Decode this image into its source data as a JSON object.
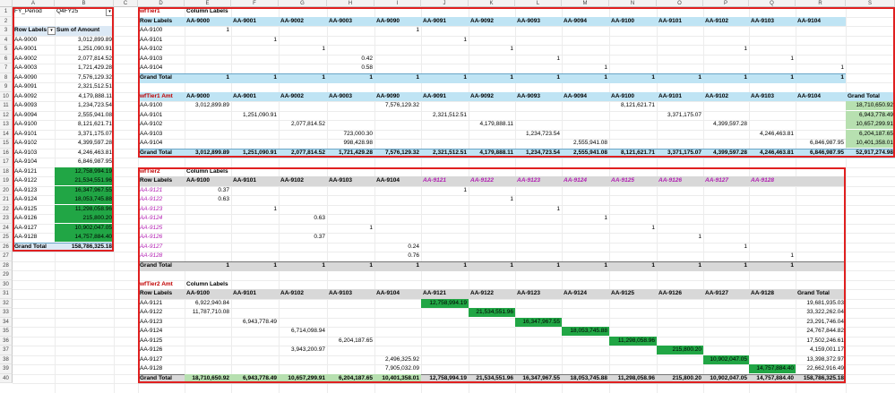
{
  "columns": [
    "A",
    "B",
    "C",
    "D",
    "E",
    "F",
    "G",
    "H",
    "I",
    "J",
    "K",
    "L",
    "M",
    "N",
    "O",
    "P",
    "Q",
    "R",
    "S"
  ],
  "rows": [
    "1",
    "2",
    "3",
    "4",
    "5",
    "6",
    "7",
    "8",
    "9",
    "10",
    "11",
    "12",
    "13",
    "14",
    "15",
    "16",
    "17",
    "18",
    "19",
    "20",
    "21",
    "22",
    "23",
    "24",
    "25",
    "26",
    "27",
    "28",
    "29",
    "30",
    "31",
    "32",
    "33",
    "34",
    "35",
    "36",
    "37",
    "38",
    "39",
    "40"
  ],
  "left_pivot": {
    "filter_label": "FY_Period",
    "filter_value": "Q4FY25",
    "row_labels_header": "Row Labels",
    "sum_header": "Sum of Amount",
    "rows": [
      {
        "label": "AA-9000",
        "value": "3,012,899.89"
      },
      {
        "label": "AA-9001",
        "value": "1,251,090.91"
      },
      {
        "label": "AA-9002",
        "value": "2,077,814.52"
      },
      {
        "label": "AA-9003",
        "value": "1,721,429.28"
      },
      {
        "label": "AA-9090",
        "value": "7,576,129.32"
      },
      {
        "label": "AA-9091",
        "value": "2,321,512.51"
      },
      {
        "label": "AA-9092",
        "value": "4,179,888.11"
      },
      {
        "label": "AA-9093",
        "value": "1,234,723.54"
      },
      {
        "label": "AA-9094",
        "value": "2,555,941.08"
      },
      {
        "label": "AA-9100",
        "value": "8,121,621.71"
      },
      {
        "label": "AA-9101",
        "value": "3,371,175.07"
      },
      {
        "label": "AA-9102",
        "value": "4,399,597.28"
      },
      {
        "label": "AA-9103",
        "value": "4,246,463.81"
      },
      {
        "label": "AA-9104",
        "value": "6,846,987.95"
      },
      {
        "label": "AA-9121",
        "value": "12,758,994.19"
      },
      {
        "label": "AA-9122",
        "value": "21,534,551.96"
      },
      {
        "label": "AA-9123",
        "value": "16,347,967.55"
      },
      {
        "label": "AA-9124",
        "value": "18,053,745.88"
      },
      {
        "label": "AA-9125",
        "value": "11,298,058.96"
      },
      {
        "label": "AA-9126",
        "value": "215,800.20"
      },
      {
        "label": "AA-9127",
        "value": "10,902,047.05"
      },
      {
        "label": "AA-9128",
        "value": "14,757,884.40"
      }
    ],
    "grand_total_label": "Grand Total",
    "grand_total": "158,786,325.18"
  },
  "wfTier1": {
    "title": "wfTier1",
    "column_labels": "Column Labels",
    "row_labels": "Row Labels",
    "headers": [
      "AA-9000",
      "AA-9001",
      "AA-9002",
      "AA-9003",
      "AA-9090",
      "AA-9091",
      "AA-9092",
      "AA-9093",
      "AA-9094",
      "AA-9100",
      "AA-9101",
      "AA-9102",
      "AA-9103",
      "AA-9104"
    ],
    "rows": [
      {
        "label": "AA-9100",
        "cells": [
          "1",
          "",
          "",
          "",
          "1",
          "",
          "",
          "",
          "",
          "",
          "",
          "",
          "",
          ""
        ]
      },
      {
        "label": "AA-9101",
        "cells": [
          "",
          "1",
          "",
          "",
          "",
          "1",
          "",
          "",
          "",
          "",
          "",
          "",
          "",
          ""
        ]
      },
      {
        "label": "AA-9102",
        "cells": [
          "",
          "",
          "1",
          "",
          "",
          "",
          "1",
          "",
          "",
          "",
          "",
          "1",
          "",
          ""
        ]
      },
      {
        "label": "AA-9103",
        "cells": [
          "",
          "",
          "",
          "0.42",
          "",
          "",
          "",
          "1",
          "",
          "",
          "",
          "",
          "1",
          ""
        ]
      },
      {
        "label": "AA-9104",
        "cells": [
          "",
          "",
          "",
          "0.58",
          "",
          "",
          "",
          "",
          "1",
          "",
          "",
          "",
          "",
          "1"
        ]
      }
    ],
    "grand_total_label": "Grand Total",
    "grand_total": [
      "1",
      "1",
      "1",
      "1",
      "1",
      "1",
      "1",
      "1",
      "1",
      "1",
      "1",
      "1",
      "1",
      "1"
    ]
  },
  "wfTier1Amt": {
    "title": "wfTier1 Amt",
    "headers": [
      "AA-9000",
      "AA-9001",
      "AA-9002",
      "AA-9003",
      "AA-9090",
      "AA-9091",
      "AA-9092",
      "AA-9093",
      "AA-9094",
      "AA-9100",
      "AA-9101",
      "AA-9102",
      "AA-9103",
      "AA-9104",
      "Grand Total"
    ],
    "rows": [
      {
        "label": "AA-9100",
        "cells": [
          "3,012,899.89",
          "",
          "",
          "",
          "7,576,129.32",
          "",
          "",
          "",
          "",
          "8,121,621.71",
          "",
          "",
          "",
          "",
          "18,710,650.92"
        ]
      },
      {
        "label": "AA-9101",
        "cells": [
          "",
          "1,251,090.91",
          "",
          "",
          "",
          "2,321,512.51",
          "",
          "",
          "",
          "",
          "3,371,175.07",
          "",
          "",
          "",
          "6,943,778.49"
        ]
      },
      {
        "label": "AA-9102",
        "cells": [
          "",
          "",
          "2,077,814.52",
          "",
          "",
          "",
          "4,179,888.11",
          "",
          "",
          "",
          "",
          "4,399,597.28",
          "",
          "",
          "10,657,299.91"
        ]
      },
      {
        "label": "AA-9103",
        "cells": [
          "",
          "",
          "",
          "723,000.30",
          "",
          "",
          "",
          "1,234,723.54",
          "",
          "",
          "",
          "",
          "4,246,463.81",
          "",
          "6,204,187.65"
        ]
      },
      {
        "label": "AA-9104",
        "cells": [
          "",
          "",
          "",
          "998,428.98",
          "",
          "",
          "",
          "",
          "2,555,941.08",
          "",
          "",
          "",
          "",
          "6,846,987.95",
          "10,401,358.01"
        ]
      }
    ],
    "grand_total_label": "Grand Total",
    "grand_total": [
      "3,012,899.89",
      "1,251,090.91",
      "2,077,814.52",
      "1,721,429.28",
      "7,576,129.32",
      "2,321,512.51",
      "4,179,888.11",
      "1,234,723.54",
      "2,555,941.08",
      "8,121,621.71",
      "3,371,175.07",
      "4,399,597.28",
      "4,246,463.81",
      "6,846,987.95",
      "52,917,274.98"
    ]
  },
  "wfTier2": {
    "title": "wfTier2",
    "column_labels": "Column Labels",
    "row_labels": "Row Labels",
    "headers": [
      "AA-9100",
      "AA-9101",
      "AA-9102",
      "AA-9103",
      "AA-9104",
      "AA-9121",
      "AA-9122",
      "AA-9123",
      "AA-9124",
      "AA-9125",
      "AA-9126",
      "AA-9127",
      "AA-9128"
    ],
    "rows": [
      {
        "label": "AA-9121",
        "cells": [
          "0.37",
          "",
          "",
          "",
          "",
          "1",
          "",
          "",
          "",
          "",
          "",
          "",
          ""
        ]
      },
      {
        "label": "AA-9122",
        "cells": [
          "0.63",
          "",
          "",
          "",
          "",
          "",
          "1",
          "",
          "",
          "",
          "",
          "",
          ""
        ]
      },
      {
        "label": "AA-9123",
        "cells": [
          "",
          "1",
          "",
          "",
          "",
          "",
          "",
          "1",
          "",
          "",
          "",
          "",
          ""
        ]
      },
      {
        "label": "AA-9124",
        "cells": [
          "",
          "",
          "0.63",
          "",
          "",
          "",
          "",
          "",
          "1",
          "",
          "",
          "",
          ""
        ]
      },
      {
        "label": "AA-9125",
        "cells": [
          "",
          "",
          "",
          "1",
          "",
          "",
          "",
          "",
          "",
          "1",
          "",
          "",
          ""
        ]
      },
      {
        "label": "AA-9126",
        "cells": [
          "",
          "",
          "0.37",
          "",
          "",
          "",
          "",
          "",
          "",
          "",
          "1",
          "",
          ""
        ]
      },
      {
        "label": "AA-9127",
        "cells": [
          "",
          "",
          "",
          "",
          "0.24",
          "",
          "",
          "",
          "",
          "",
          "",
          "1",
          ""
        ]
      },
      {
        "label": "AA-9128",
        "cells": [
          "",
          "",
          "",
          "",
          "0.76",
          "",
          "",
          "",
          "",
          "",
          "",
          "",
          "1"
        ]
      }
    ],
    "grand_total_label": "Grand Total",
    "grand_total": [
      "1",
      "1",
      "1",
      "1",
      "1",
      "1",
      "1",
      "1",
      "1",
      "1",
      "1",
      "1",
      "1"
    ]
  },
  "wfTier2Amt": {
    "title": "wfTier2 Amt",
    "column_labels": "Column Labels",
    "row_labels": "Row Labels",
    "headers": [
      "AA-9100",
      "AA-9101",
      "AA-9102",
      "AA-9103",
      "AA-9104",
      "AA-9121",
      "AA-9122",
      "AA-9123",
      "AA-9124",
      "AA-9125",
      "AA-9126",
      "AA-9127",
      "AA-9128",
      "Grand Total"
    ],
    "rows": [
      {
        "label": "AA-9121",
        "cells": [
          "6,922,940.84",
          "",
          "",
          "",
          "",
          "12,758,994.19",
          "",
          "",
          "",
          "",
          "",
          "",
          "",
          "19,681,935.03"
        ]
      },
      {
        "label": "AA-9122",
        "cells": [
          "11,787,710.08",
          "",
          "",
          "",
          "",
          "",
          "21,534,551.96",
          "",
          "",
          "",
          "",
          "",
          "",
          "33,322,262.04"
        ]
      },
      {
        "label": "AA-9123",
        "cells": [
          "",
          "6,943,778.49",
          "",
          "",
          "",
          "",
          "",
          "16,347,967.55",
          "",
          "",
          "",
          "",
          "",
          "23,291,746.04"
        ]
      },
      {
        "label": "AA-9124",
        "cells": [
          "",
          "",
          "6,714,098.94",
          "",
          "",
          "",
          "",
          "",
          "18,053,745.88",
          "",
          "",
          "",
          "",
          "24,767,844.82"
        ]
      },
      {
        "label": "AA-9125",
        "cells": [
          "",
          "",
          "",
          "6,204,187.65",
          "",
          "",
          "",
          "",
          "",
          "11,298,058.96",
          "",
          "",
          "",
          "17,502,246.61"
        ]
      },
      {
        "label": "AA-9126",
        "cells": [
          "",
          "",
          "3,943,200.97",
          "",
          "",
          "",
          "",
          "",
          "",
          "",
          "215,800.20",
          "",
          "",
          "4,159,001.17"
        ]
      },
      {
        "label": "AA-9127",
        "cells": [
          "",
          "",
          "",
          "",
          "2,496,325.92",
          "",
          "",
          "",
          "",
          "",
          "",
          "10,902,047.05",
          "",
          "13,398,372.97"
        ]
      },
      {
        "label": "AA-9128",
        "cells": [
          "",
          "",
          "",
          "",
          "7,905,032.09",
          "",
          "",
          "",
          "",
          "",
          "",
          "",
          "14,757,884.40",
          "22,662,916.49"
        ]
      }
    ],
    "grand_total_label": "Grand Total",
    "grand_total": [
      "18,710,650.92",
      "6,943,778.49",
      "10,657,299.91",
      "6,204,187.65",
      "10,401,358.01",
      "12,758,994.19",
      "21,534,551.96",
      "16,347,967.55",
      "18,053,745.88",
      "11,298,058.96",
      "215,800.20",
      "10,902,047.05",
      "14,757,884.40",
      "158,786,325.18"
    ]
  },
  "colors": {
    "accent_red": "#e02020",
    "header_blue": "#bfe4f4",
    "header_gray": "#d8d8d8",
    "light_green": "#b7e0b0",
    "dark_green": "#21a645",
    "tier2_label": "#b21eb2"
  }
}
